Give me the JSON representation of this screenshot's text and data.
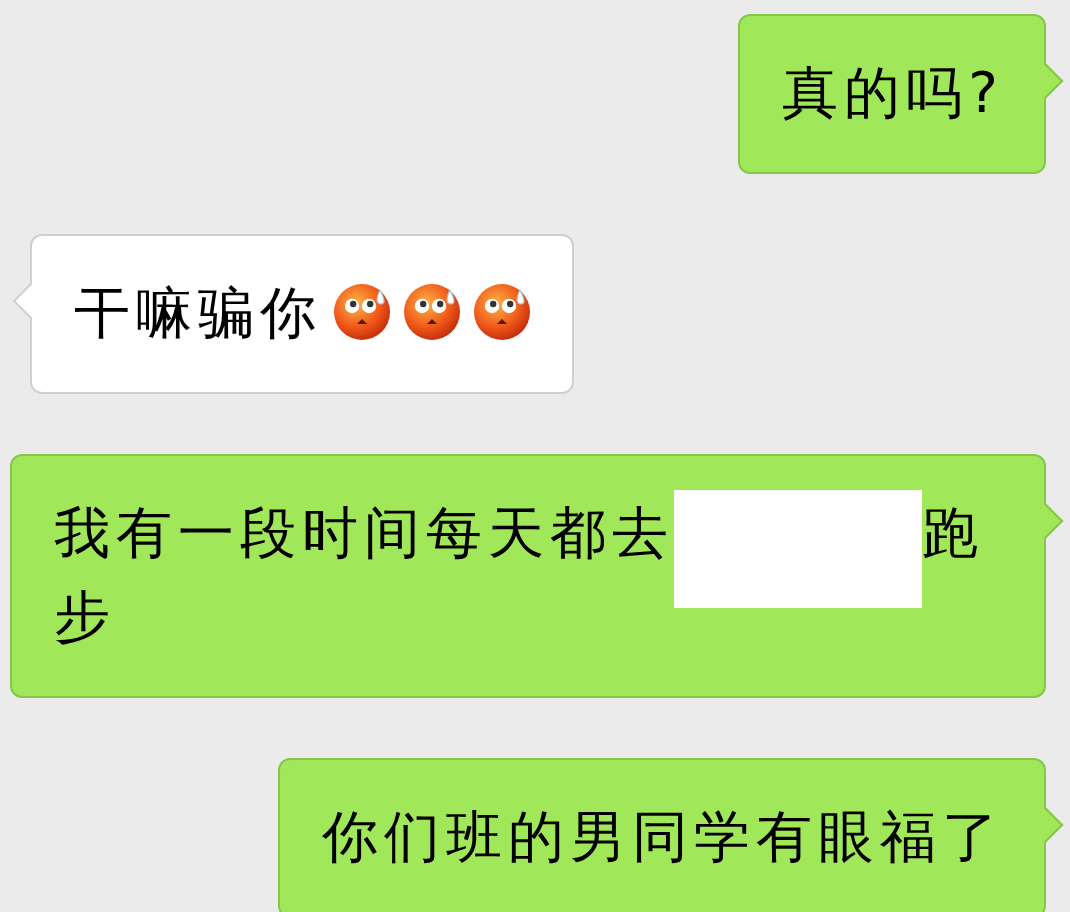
{
  "messages": [
    {
      "outgoing": true,
      "parts": [
        {
          "kind": "text",
          "text": "真的吗?"
        }
      ]
    },
    {
      "outgoing": false,
      "parts": [
        {
          "kind": "text",
          "text": "干嘛骗你"
        },
        {
          "kind": "emoji"
        },
        {
          "kind": "emoji"
        },
        {
          "kind": "emoji"
        }
      ]
    },
    {
      "outgoing": true,
      "parts": [
        {
          "kind": "text",
          "text": "我有一段时间每天都去"
        },
        {
          "kind": "redaction"
        },
        {
          "kind": "text",
          "text": "跑"
        },
        {
          "kind": "text",
          "text": "步"
        }
      ]
    },
    {
      "outgoing": true,
      "parts": [
        {
          "kind": "text",
          "text": "你们班的男同学有眼福了"
        }
      ]
    }
  ]
}
